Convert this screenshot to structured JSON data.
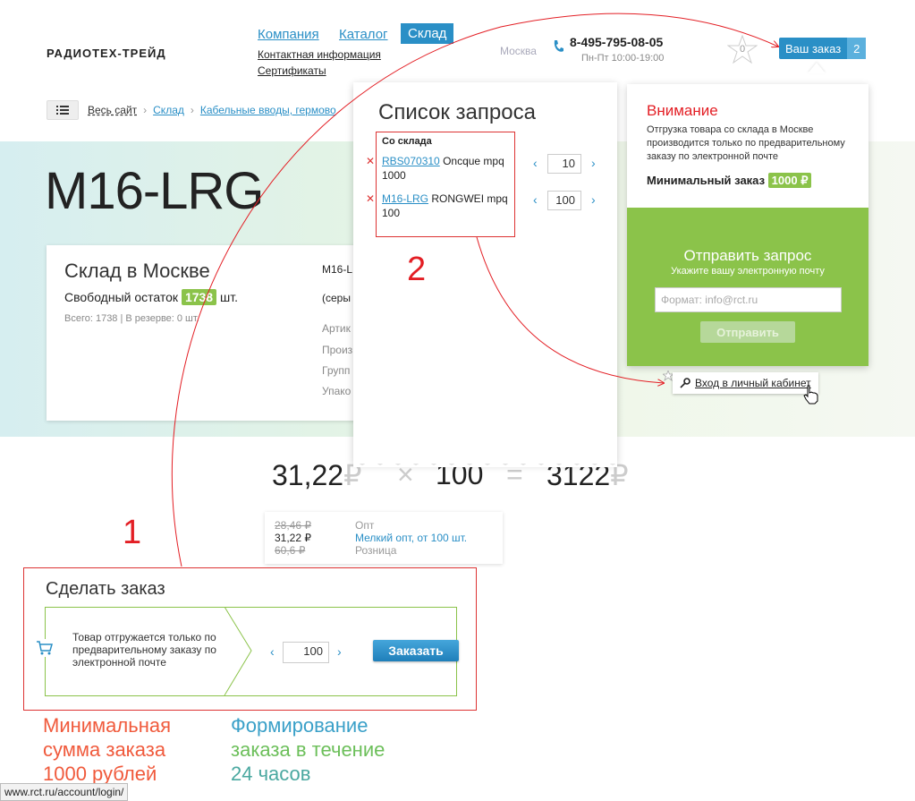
{
  "header": {
    "logo": "РАДИОТЕХ-ТРЕЙД",
    "nav": [
      "Компания",
      "Каталог",
      "Склад"
    ],
    "subnav": [
      "Контактная информация",
      "Сертификаты"
    ],
    "city": "Москва",
    "phone": "8-495-795-08-05",
    "hours": "Пн-Пт 10:00-19:00",
    "favorites_count": "0",
    "order_label": "Ваш заказ",
    "order_count": "2"
  },
  "breadcrumb": {
    "items": [
      "Весь сайт",
      "Склад",
      "Кабельные вводы, гермово"
    ]
  },
  "product": {
    "title": "M16-LRG",
    "stock_title": "Склад в Москве",
    "free_label": "Свободный остаток",
    "free_value": "1738",
    "free_unit": "шт.",
    "totals": "Всего: 1738 | В резерве: 0 шт.",
    "code_partial": "M16-L",
    "desc_partial": "(серы",
    "attr_labels": [
      "Артик",
      "Произ",
      "Групп",
      "Упако"
    ]
  },
  "pricing": {
    "unit_price": "31,22",
    "currency": "₽",
    "times": "×",
    "qty": "100",
    "equals": "=",
    "total": "3122",
    "tiers": [
      {
        "price": "28,46 ₽",
        "label": "Опт",
        "active": false
      },
      {
        "price": "31,22 ₽",
        "label": "Мелкий опт, от 100 шт.",
        "active": true
      },
      {
        "price": "60,6 ₽",
        "label": "Розница",
        "active": false
      }
    ]
  },
  "order": {
    "title": "Сделать заказ",
    "note": "Товар отгружается только по предварительному заказу по электронной почте",
    "qty": "100",
    "button": "Заказать",
    "prev": "‹",
    "next": "›"
  },
  "slogans": {
    "left": [
      "Минимальная",
      "сумма заказа",
      "1000 рублей"
    ],
    "right": [
      "Формирование",
      "заказа в течение",
      "24 часов"
    ]
  },
  "request_popup": {
    "title": "Список запроса",
    "section": "Со склада",
    "items": [
      {
        "code": "RBS070310",
        "desc": "Oncque mpq 1000",
        "qty": "10"
      },
      {
        "code": "M16-LRG",
        "desc": "RONGWEI mpq 100",
        "qty": "100"
      }
    ]
  },
  "alert": {
    "title": "Внимание",
    "text": "Отгрузка товара со склада в Москве производится только по предварительному заказу по электронной почте",
    "min_label": "Минимальный заказ",
    "min_value": "1000 ₽",
    "send_title": "Отправить запрос",
    "send_sub": "Укажите вашу электронную почту",
    "email_placeholder": "Формат: info@rct.ru",
    "send_button": "Отправить"
  },
  "login": {
    "label": "Вход в личный кабинет"
  },
  "status_url": "www.rct.ru/account/login/",
  "annotations": [
    "1",
    "2"
  ],
  "colors": {
    "accent": "#2a8fc6",
    "green": "#8bc34a",
    "red": "#e31e24"
  }
}
